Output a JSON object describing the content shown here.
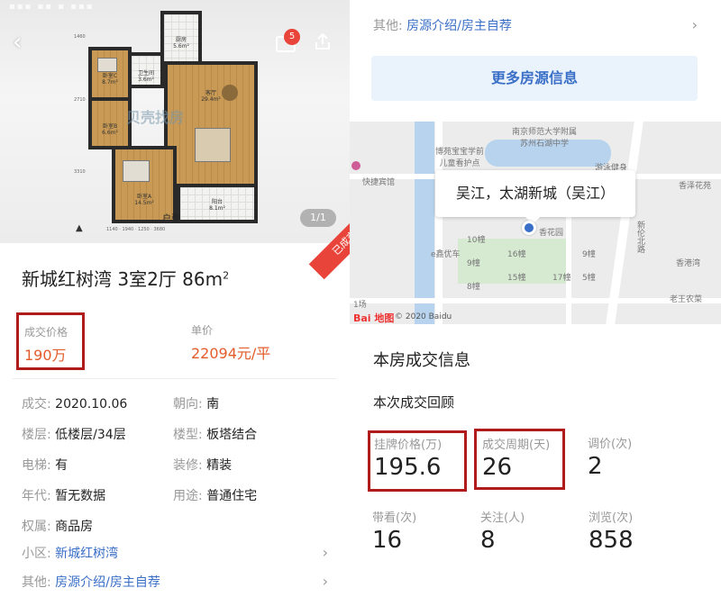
{
  "left": {
    "status_bar": "▪▪▪ ▪▪ ▪ ▪▪▪",
    "page_counter": "1/1",
    "message_badge": "5",
    "watermark": "贝壳找房",
    "floorplan": {
      "kitchen": "厨房\n5.6m²",
      "bath": "卫生间\n3.6m²",
      "bedroom2": "卧室C\n8.7m²",
      "bedroom3": "卧室B\n6.6m²",
      "living": "客厅\n29.4m²",
      "bedroom1": "卧室A\n14.5m²",
      "balcony": "阳台\n8.1m²",
      "entry": "户型",
      "dims_bottom": "1140 · 1940 · 1250 · 3680"
    },
    "title": "新城红树湾 3室2厅 86m",
    "title_sup": "2",
    "sold_ribbon": "已成交",
    "deal_price_label": "成交价格",
    "deal_price_value": "190万",
    "unit_price_label": "单价",
    "unit_price_value": "22094元/平",
    "details": [
      {
        "k": "成交:",
        "v": "2020.10.06"
      },
      {
        "k": "朝向:",
        "v": "南"
      },
      {
        "k": "楼层:",
        "v": "低楼层/34层"
      },
      {
        "k": "楼型:",
        "v": "板塔结合"
      },
      {
        "k": "电梯:",
        "v": "有"
      },
      {
        "k": "装修:",
        "v": "精装"
      },
      {
        "k": "年代:",
        "v": "暂无数据"
      },
      {
        "k": "用途:",
        "v": "普通住宅"
      },
      {
        "k": "权属:",
        "v": "商品房"
      }
    ],
    "community_label": "小区:",
    "community_value": "新城红树湾",
    "other_label": "其他:",
    "other_value": "房源介绍/房主自荐"
  },
  "right": {
    "other_label": "其他:",
    "other_value": "房源介绍/房主自荐",
    "more_button": "更多房源信息",
    "map": {
      "bubble": "吴江，太湖新城（吴江）",
      "labels": {
        "school1": "南京师范大学附属\n苏州石湖中学",
        "school2": "博苑宝宝学前\n儿童看护点",
        "hotel": "快捷宾馆",
        "gym": "游泳健身",
        "shop": "e鑫优车",
        "garden": "香花园",
        "bay": "香港湾",
        "road1": "新伦北路",
        "garden2": "香泽花苑",
        "farm": "老王农菜",
        "b1": "10幢",
        "b2": "9幢",
        "b3": "8幢",
        "b4": "16幢",
        "b5": "15幢",
        "b6": "17幢",
        "b7": "9幢",
        "b8": "5幢",
        "site": "1场"
      },
      "logo": "Bai 地图",
      "copyright": "© 2020 Baidu"
    },
    "section_title": "本房成交信息",
    "sub_title": "本次成交回顾",
    "stats": {
      "list_price": {
        "label": "挂牌价格(万)",
        "value": "195.6"
      },
      "cycle": {
        "label": "成交周期(天)",
        "value": "26"
      },
      "adjust": {
        "label": "调价(次)",
        "value": "2"
      },
      "visit": {
        "label": "带看(次)",
        "value": "16"
      },
      "follow": {
        "label": "关注(人)",
        "value": "8"
      },
      "views": {
        "label": "浏览(次)",
        "value": "858"
      }
    }
  },
  "colors": {
    "accent_red": "#b01c1c",
    "price_orange": "#e35b2a",
    "link_blue": "#3a6fc7",
    "ribbon_red": "#e8443a"
  },
  "icons": {
    "back": "back-arrow-icon",
    "message": "message-icon",
    "share": "share-icon",
    "chevron": "chevron-right-icon"
  }
}
